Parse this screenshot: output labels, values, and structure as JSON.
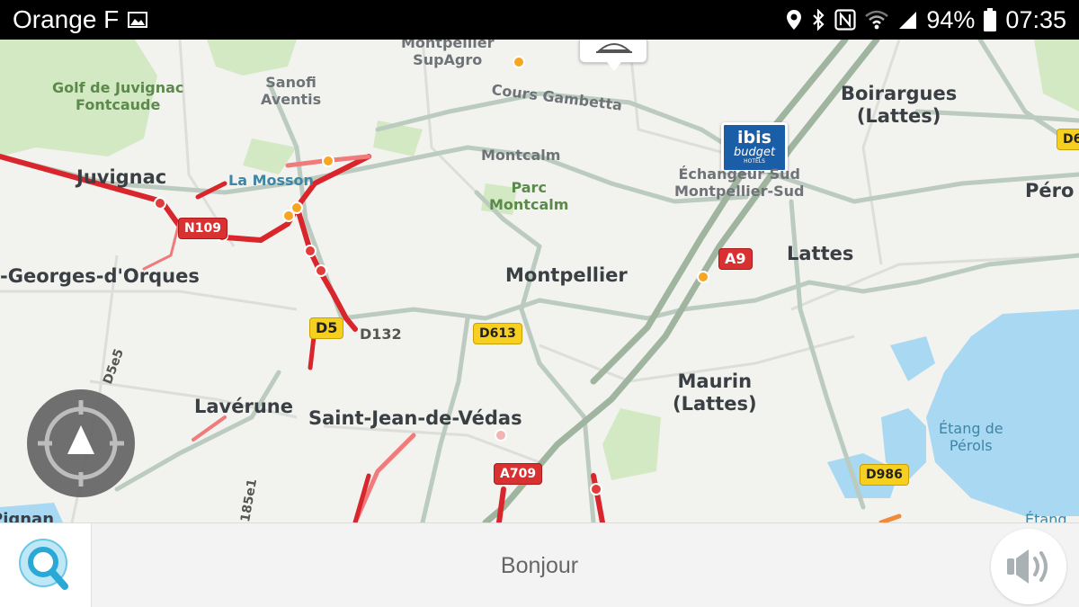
{
  "status_bar": {
    "carrier": "Orange F",
    "battery": "94%",
    "time": "07:35",
    "icons": [
      "gallery-icon",
      "location-icon",
      "bluetooth-icon",
      "nfc-icon",
      "wifi-icon",
      "signal-icon",
      "battery-icon"
    ]
  },
  "map": {
    "places": {
      "juvignac": "Juvignac",
      "golf": "Golf de Juvignac\nFontcaude",
      "sanofi": "Sanofi\nAventis",
      "supagro": "Montpellier\nSupAgro",
      "cours_gambetta": "Cours Gambetta",
      "montcalm": "Montcalm",
      "parc_montcalm": "Parc\nMontcalm",
      "la_mosson": "La Mosson",
      "boirargues": "Boirargues\n(Lattes)",
      "echangeur": "Échangeur Sud\nMontpellier-Sud",
      "pero": "Péro",
      "georges": "-Georges-d'Orques",
      "montpellier": "Montpellier",
      "lattes": "Lattes",
      "laverune": "Lavérune",
      "saint_jean": "Saint-Jean-de-Védas",
      "maurin": "Maurin\n(Lattes)",
      "etang_perols": "Étang de\nPérols",
      "pignan": "Pignan",
      "etang_bottom": "Étang",
      "d132": "D132",
      "d5e5": "D5e5",
      "d185e1": "185e1"
    },
    "shields": {
      "n109": "N109",
      "a9": "A9",
      "d5": "D5",
      "d613": "D613",
      "a709": "A709",
      "d986": "D986",
      "d6": "D6"
    },
    "poi": {
      "ibis_line1": "ibis",
      "ibis_line2": "budget",
      "ibis_line3": "HOTELS"
    },
    "colors": {
      "traffic_red": "#d8262c",
      "traffic_light": "#ef7b7b",
      "road": "#b9c7bd",
      "water": "#a9d8f2",
      "park": "#cfe6bf"
    }
  },
  "bottom_bar": {
    "greeting": "Bonjour",
    "search_icon": "search-icon",
    "sound_icon": "speaker-icon"
  }
}
